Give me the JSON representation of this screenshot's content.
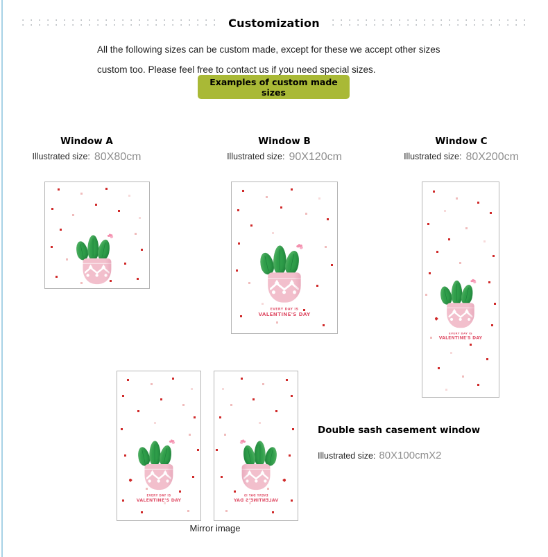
{
  "header": {
    "title": "Customization",
    "rail_icon": "dotted-rail"
  },
  "intro": {
    "line1": "All the following sizes can be custom made, except for these we accept other sizes",
    "line2": "custom too. Please feel free to contact us if you need special sizes."
  },
  "cta": {
    "label": "Examples of custom made sizes",
    "color": "#a9b936"
  },
  "size_label": "Illustrated size:",
  "windows": [
    {
      "title": "Window A",
      "size": "80X80cm"
    },
    {
      "title": "Window B",
      "size": "90X120cm"
    },
    {
      "title": "Window C",
      "size": "80X200cm"
    }
  ],
  "double_sash": {
    "title": "Double sash casement window",
    "size_label": "Illustrated size:",
    "size": "80X100cmX2"
  },
  "mirror_caption": "Mirror image",
  "artwork": {
    "slogan_line1": "EVERY DAY IS",
    "slogan_line2": "VALENTINE'S DAY",
    "cactus_color": "#2f9e4a",
    "pot_color": "#f2bfcc",
    "flower_color": "#f490ae",
    "dot_color": "#d02a2a",
    "slogan_color": "#e0536b"
  }
}
